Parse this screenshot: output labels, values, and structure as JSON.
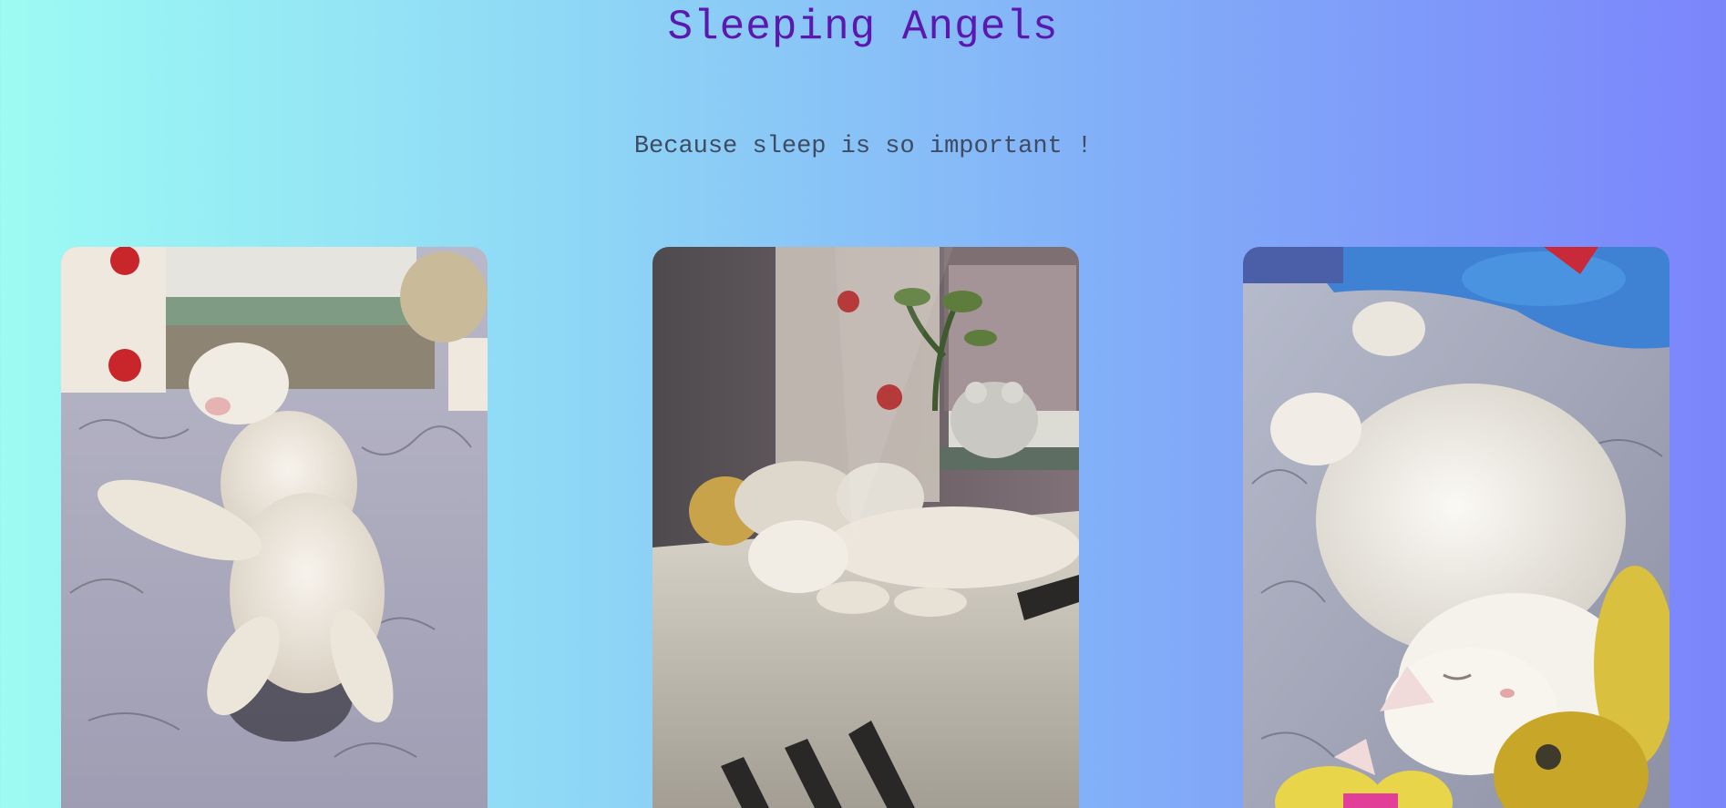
{
  "header": {
    "title": "Sleeping Angels",
    "subtitle": "Because sleep is so important !"
  },
  "gallery": {
    "photos": [
      {
        "subject": "white cat sleeping on its back on floral bedding by a window"
      },
      {
        "subject": "white cat lying on a rumpled bed next to a plush toy and a frog figurine on the windowsill"
      },
      {
        "subject": "close-up of a white fluffy cat sleeping curled on bedding with plush toys"
      }
    ]
  },
  "colors": {
    "title": "#5b18b0",
    "subtitle": "#3e4b63",
    "gradient_start": "#9cfbf3",
    "gradient_end": "#7b85fb"
  }
}
